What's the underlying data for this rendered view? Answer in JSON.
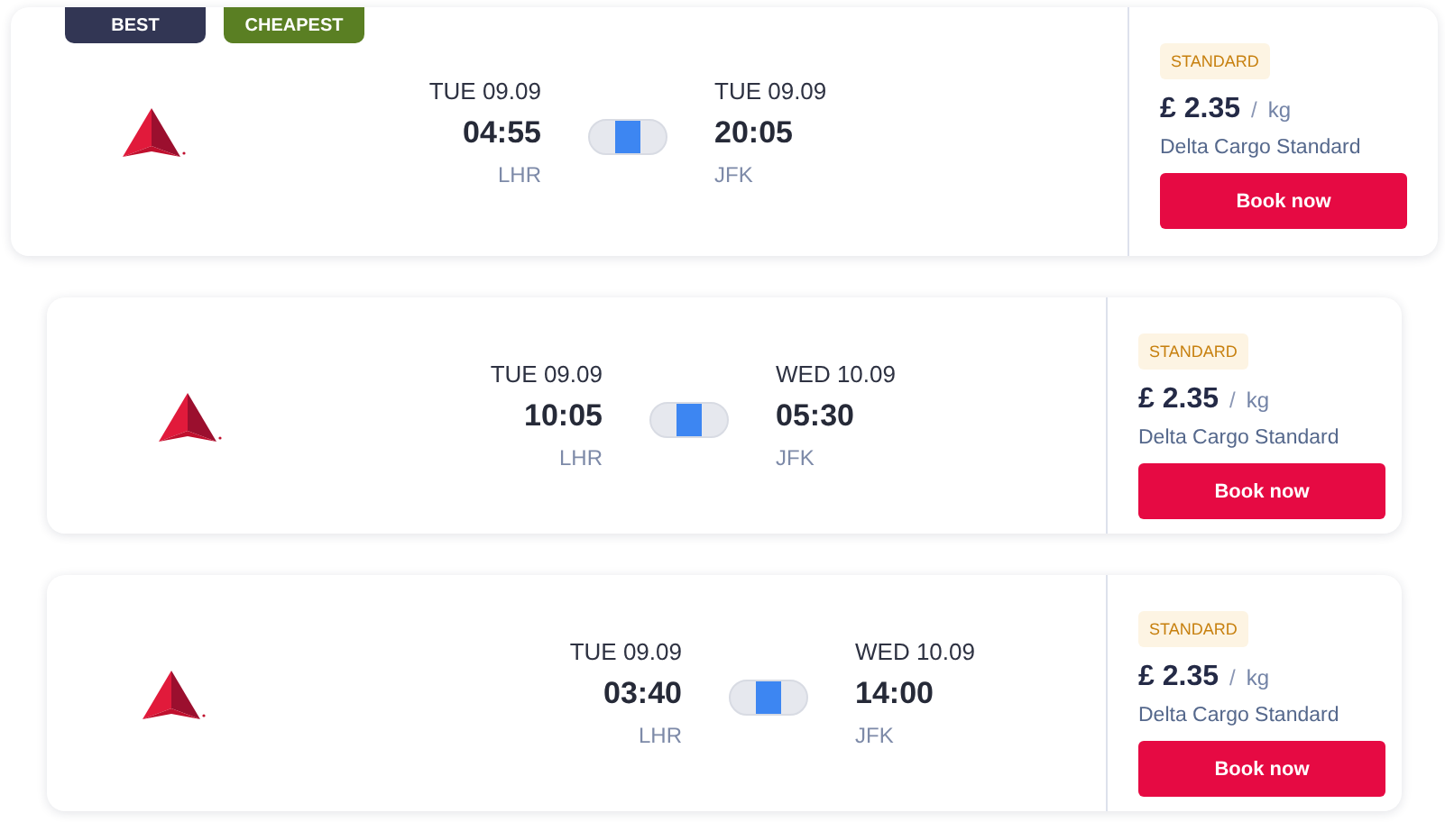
{
  "offers": [
    {
      "tags": [
        {
          "label": "BEST",
          "kind": "best"
        },
        {
          "label": "CHEAPEST",
          "kind": "cheapest"
        }
      ],
      "departure": {
        "date": "TUE 09.09",
        "time": "04:55",
        "airport": "LHR"
      },
      "arrival": {
        "date": "TUE 09.09",
        "time": "20:05",
        "airport": "JFK"
      },
      "fare": {
        "badge": "STANDARD",
        "currency": "£",
        "price": "2.35",
        "separator": "/",
        "unit": "kg",
        "product": "Delta Cargo Standard",
        "button": "Book now"
      }
    },
    {
      "departure": {
        "date": "TUE 09.09",
        "time": "10:05",
        "airport": "LHR"
      },
      "arrival": {
        "date": "WED 10.09",
        "time": "05:30",
        "airport": "JFK"
      },
      "fare": {
        "badge": "STANDARD",
        "currency": "£",
        "price": "2.35",
        "separator": "/",
        "unit": "kg",
        "product": "Delta Cargo Standard",
        "button": "Book now"
      }
    },
    {
      "departure": {
        "date": "TUE 09.09",
        "time": "03:40",
        "airport": "LHR"
      },
      "arrival": {
        "date": "WED 10.09",
        "time": "14:00",
        "airport": "JFK"
      },
      "fare": {
        "badge": "STANDARD",
        "currency": "£",
        "price": "2.35",
        "separator": "/",
        "unit": "kg",
        "product": "Delta Cargo Standard",
        "button": "Book now"
      }
    }
  ]
}
